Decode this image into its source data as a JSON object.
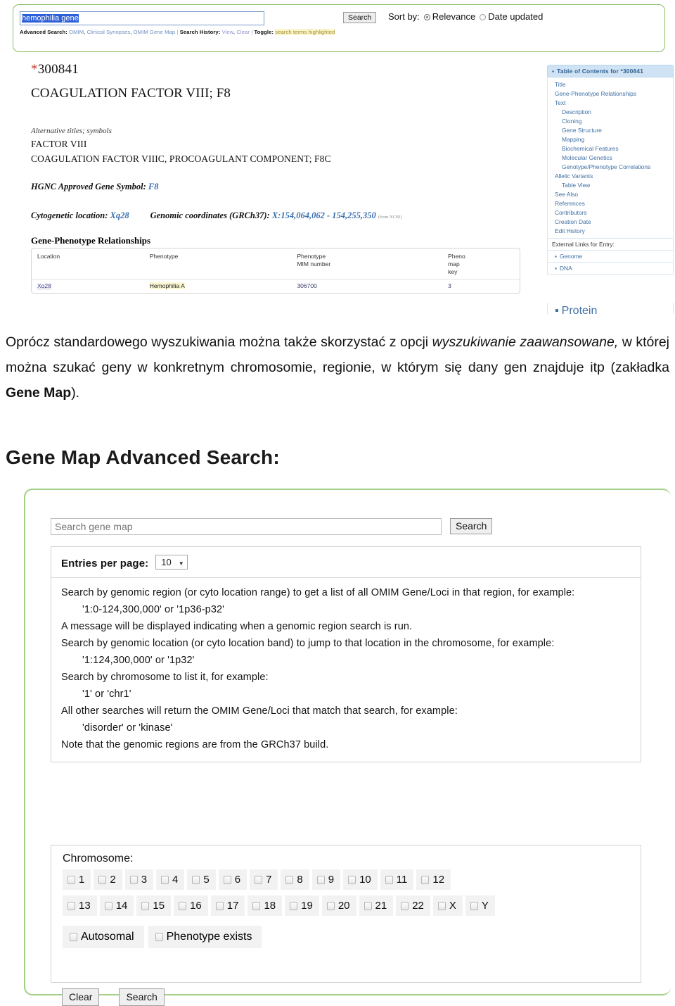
{
  "omim_screenshot": {
    "search_bar": {
      "query_value": "hemophilia gene",
      "search_button": "Search",
      "sort_by_label": "Sort by:",
      "sort_options": [
        "Relevance",
        "Date updated"
      ],
      "selected_sort": "Relevance",
      "advanced_search_label": "Advanced Search:",
      "advanced_links": [
        "OMIM",
        "Clinical Synopses",
        "OMIM Gene Map"
      ],
      "search_history_label": "Search History:",
      "history_links": [
        "View",
        "Clear"
      ],
      "toggle_label": "Toggle:",
      "toggle_value": "search terms highlighted"
    },
    "entry": {
      "mim_prefix": "*",
      "mim_number": "300841",
      "title": "COAGULATION FACTOR VIII; F8",
      "alt_titles_label": "Alternative titles; symbols",
      "alt_titles": [
        "FACTOR VIII",
        "COAGULATION FACTOR VIIIC, PROCOAGULANT COMPONENT; F8C"
      ],
      "hgnc_label": "HGNC Approved Gene Symbol:",
      "hgnc_value": "F8",
      "cyto_label": "Cytogenetic location:",
      "cyto_value": "Xq28",
      "coord_label": "Genomic coordinates (GRCh37):",
      "coord_value": "X:154,064,062 - 154,255,350",
      "coord_source": "(from NCBI)"
    },
    "gene_phenotype": {
      "section_title": "Gene-Phenotype Relationships",
      "headers": [
        "Location",
        "Phenotype",
        "Phenotype\nMIM number",
        "Pheno\nmap\nkey"
      ],
      "header_location": "Location",
      "header_phenotype": "Phenotype",
      "header_mim_l1": "Phenotype",
      "header_mim_l2": "MIM number",
      "header_key_l1": "Pheno",
      "header_key_l2": "map",
      "header_key_l3": "key",
      "rows": [
        {
          "location": "Xq28",
          "phenotype": "Hemophilia A",
          "mim_number": "306700",
          "map_key": "3"
        }
      ]
    },
    "toc": {
      "title": "Table of Contents for *300841",
      "items": [
        {
          "label": "Title",
          "level": 1
        },
        {
          "label": "Gene-Phenotype Relationships",
          "level": 1
        },
        {
          "label": "Text",
          "level": 1
        },
        {
          "label": "Description",
          "level": 2
        },
        {
          "label": "Cloning",
          "level": 2
        },
        {
          "label": "Gene Structure",
          "level": 2
        },
        {
          "label": "Mapping",
          "level": 2
        },
        {
          "label": "Biochemical Features",
          "level": 2
        },
        {
          "label": "Molecular Genetics",
          "level": 2
        },
        {
          "label": "Genotype/Phenotype Correlations",
          "level": 2
        },
        {
          "label": "Allelic Variants",
          "level": 1
        },
        {
          "label": "Table View",
          "level": 2
        },
        {
          "label": "See Also",
          "level": 1
        },
        {
          "label": "References",
          "level": 1
        },
        {
          "label": "Contributors",
          "level": 1
        },
        {
          "label": "Creation Date",
          "level": 1
        },
        {
          "label": "Edit History",
          "level": 1
        }
      ],
      "external_links_label": "External Links for Entry:",
      "external_links": [
        "Genome",
        "DNA",
        "Protein"
      ]
    }
  },
  "body_text": {
    "paragraph_part1": "Oprócz standardowego wyszukiwania można także skorzystać z opcji ",
    "paragraph_italic": "wyszukiwanie zaawansowane,",
    "paragraph_part2": " w której można szukać geny w konkretnym chromosomie, regionie, w którym się dany gen znajduje itp (zakładka ",
    "paragraph_bold": "Gene Map",
    "paragraph_part3": ")."
  },
  "section_heading": "Gene Map Advanced Search:",
  "gene_map_screenshot": {
    "search": {
      "placeholder": "Search gene map",
      "value": "",
      "button_label": "Search"
    },
    "entries_per_page": {
      "label": "Entries per page:",
      "selected": "10",
      "caret": "▼"
    },
    "help_lines": [
      {
        "text": "Search by genomic region (or cyto location range) to get a list of all OMIM Gene/Loci in that region, for example:",
        "indent": false
      },
      {
        "text": "'1:0-124,300,000' or '1p36-p32'",
        "indent": true
      },
      {
        "text": "A message will be displayed indicating when a genomic region search is run.",
        "indent": false
      },
      {
        "text": "Search by genomic location (or cyto location band) to jump to that location in the chromosome, for example:",
        "indent": false
      },
      {
        "text": "'1:124,300,000' or '1p32'",
        "indent": true
      },
      {
        "text": "Search by chromosome to list it, for example:",
        "indent": false
      },
      {
        "text": "'1' or 'chr1'",
        "indent": true
      },
      {
        "text": "All other searches will return the OMIM Gene/Loci that match that search, for example:",
        "indent": false
      },
      {
        "text": "'disorder' or 'kinase'",
        "indent": true
      },
      {
        "text": "Note that the genomic regions are from the GRCh37 build.",
        "indent": false
      }
    ],
    "chromosome": {
      "label": "Chromosome:",
      "row1": [
        "1",
        "2",
        "3",
        "4",
        "5",
        "6",
        "7",
        "8",
        "9",
        "10",
        "11",
        "12"
      ],
      "row2": [
        "13",
        "14",
        "15",
        "16",
        "17",
        "18",
        "19",
        "20",
        "21",
        "22",
        "X",
        "Y"
      ],
      "options": [
        "Autosomal",
        "Phenotype exists"
      ]
    },
    "buttons": [
      "Clear",
      "Search"
    ]
  }
}
